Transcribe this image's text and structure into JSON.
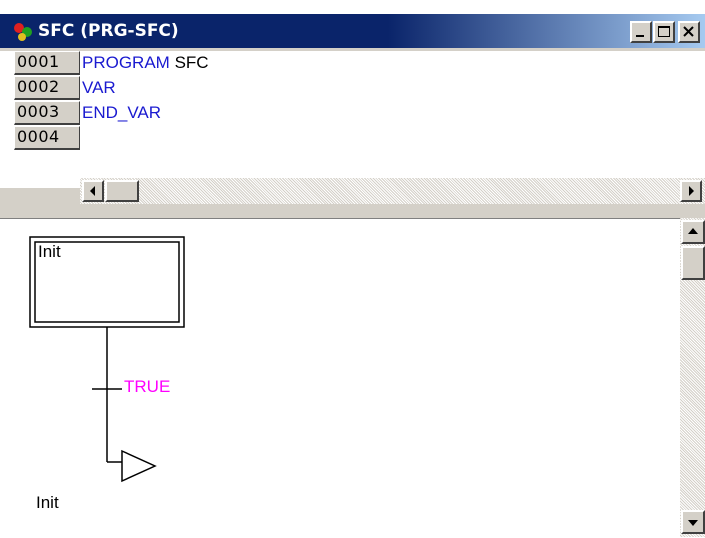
{
  "window": {
    "title": "SFC (PRG-SFC)",
    "icon": "sfc-program-icon"
  },
  "declaration": {
    "lines": [
      {
        "number": "0001",
        "keyword": "PROGRAM",
        "identifier": " SFC"
      },
      {
        "number": "0002",
        "keyword": "VAR",
        "identifier": ""
      },
      {
        "number": "0003",
        "keyword": "END_VAR",
        "identifier": ""
      },
      {
        "number": "0004",
        "keyword": "",
        "identifier": ""
      }
    ]
  },
  "sfc": {
    "init_step": "Init",
    "transition": "TRUE",
    "jump_target": "Init"
  },
  "colors": {
    "keyword": "#1a1ad0",
    "transition": "#ff00ff",
    "titlebar": "#0a246a"
  }
}
